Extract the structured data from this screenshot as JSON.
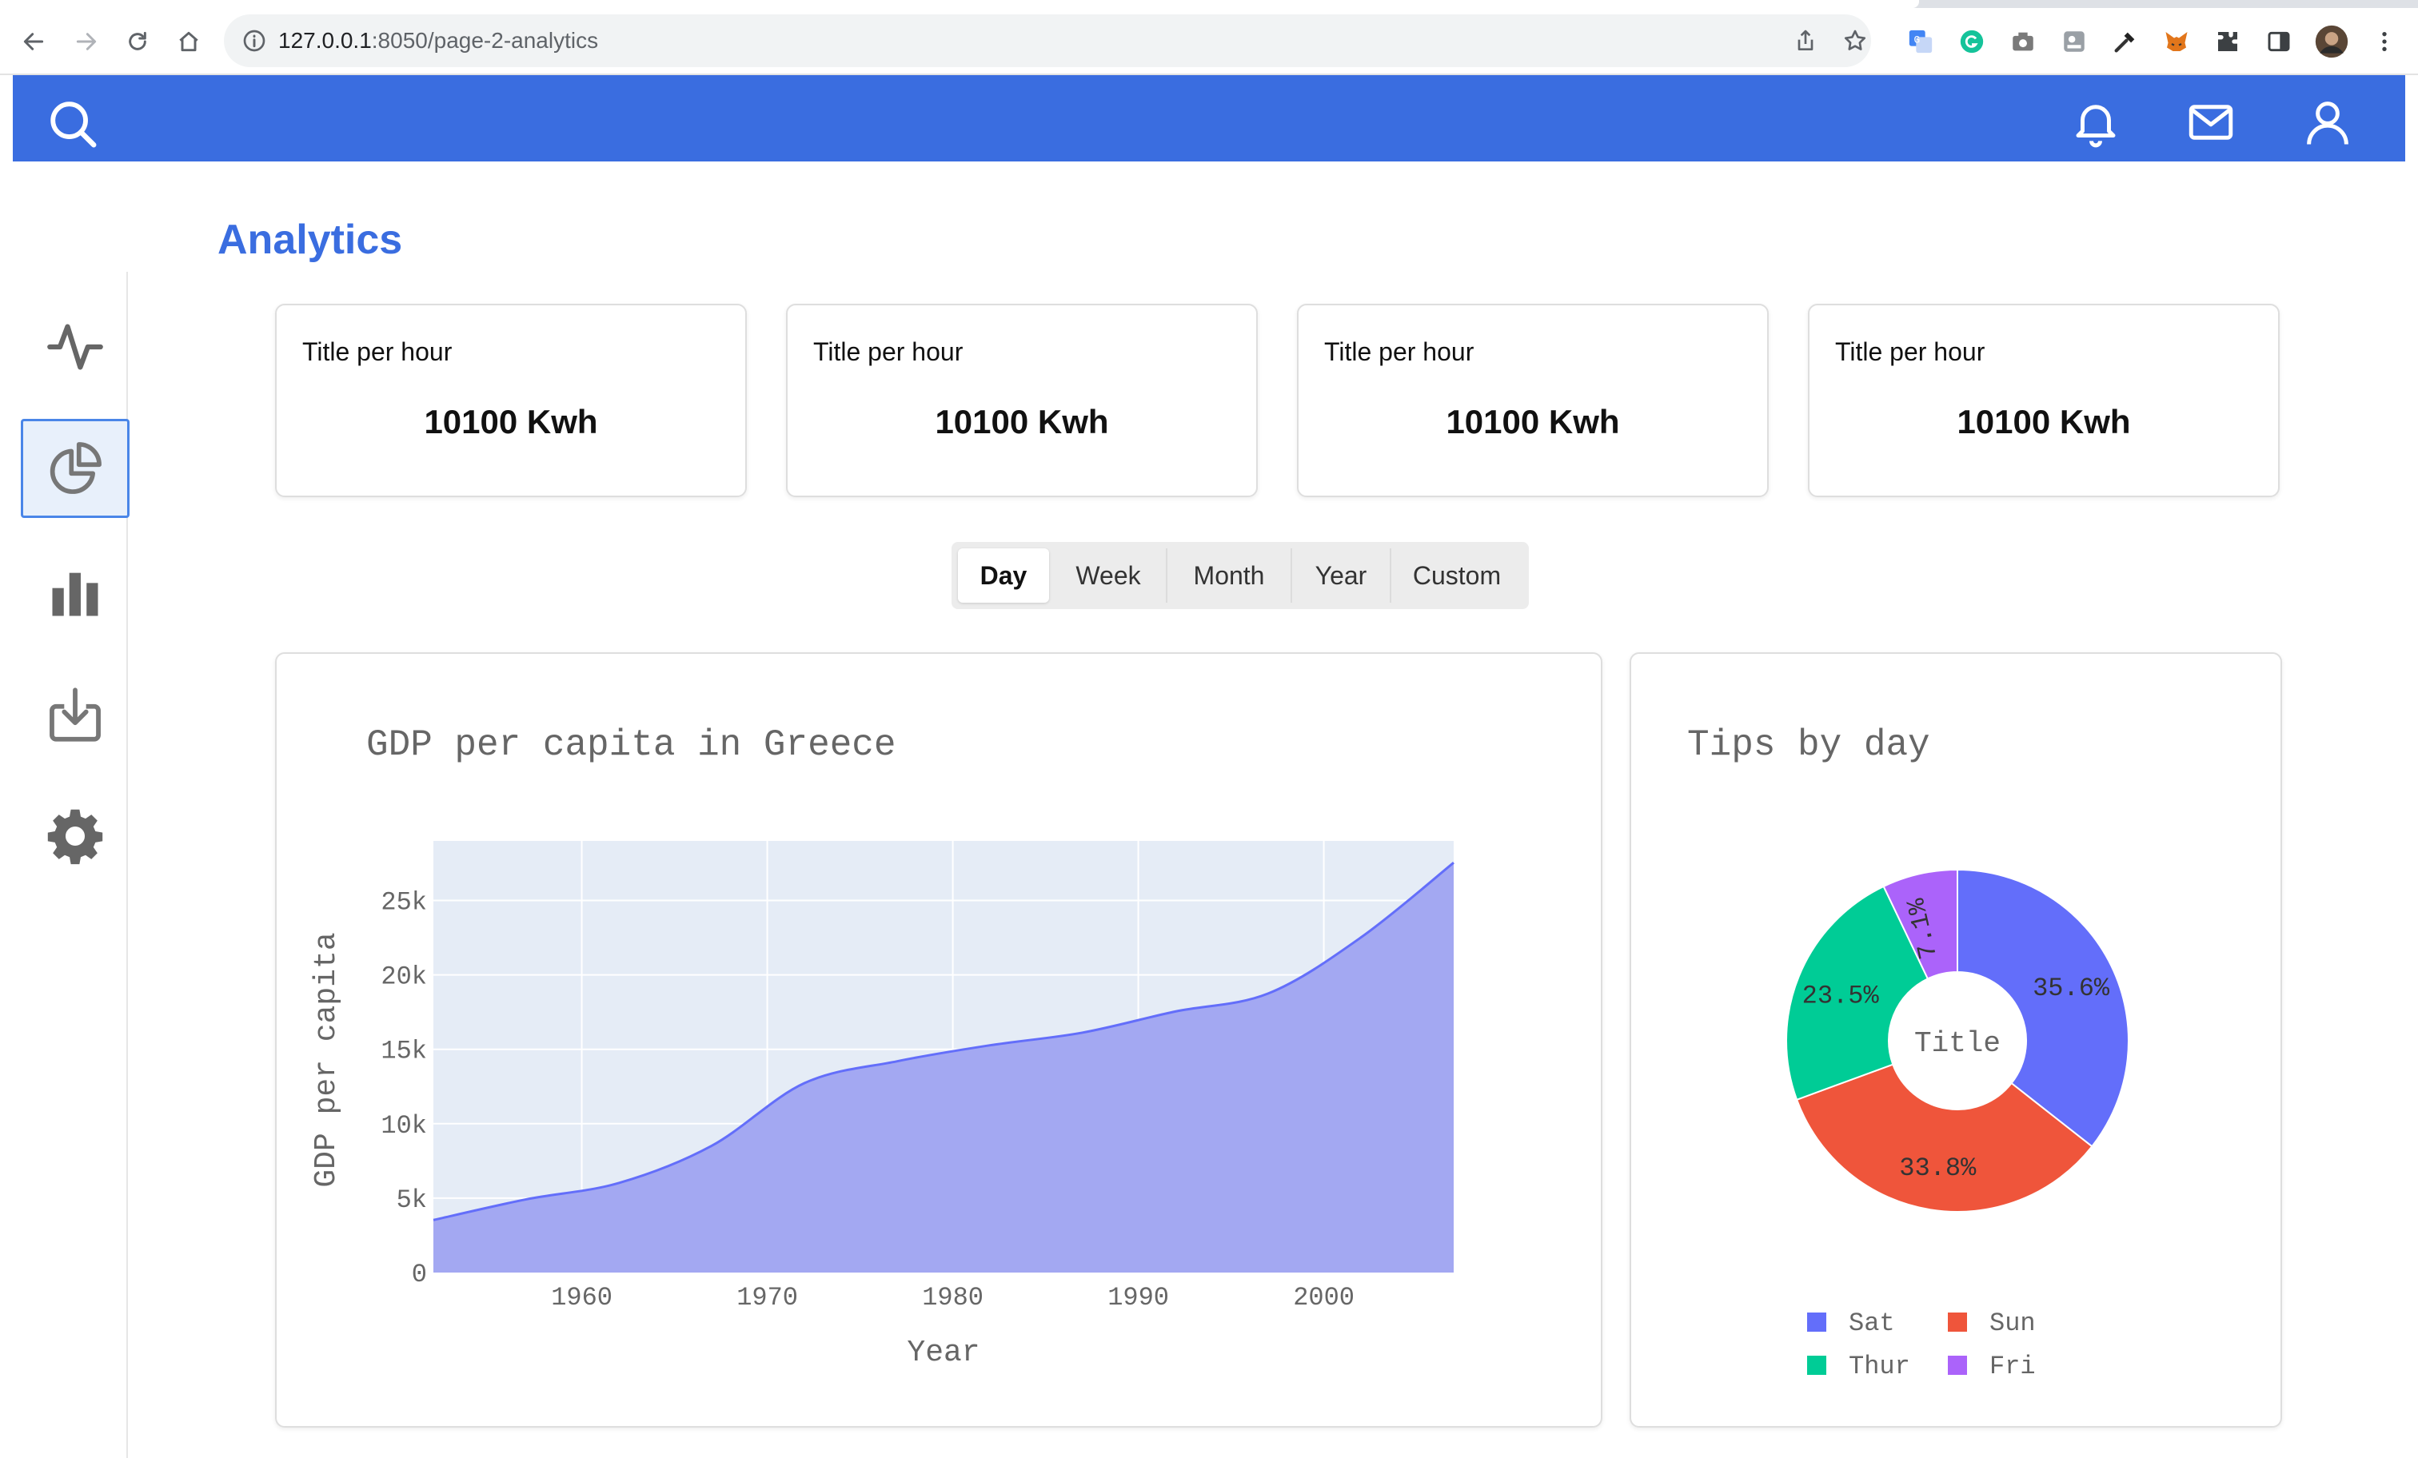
{
  "browser": {
    "url_host": "127.0.0.1",
    "url_path": ":8050/page-2-analytics"
  },
  "header": {
    "icons": [
      "search-icon",
      "bell-icon",
      "mail-icon",
      "user-icon"
    ],
    "color": "#3a6de0"
  },
  "sidebar": {
    "items": [
      {
        "icon": "activity-icon",
        "active": false
      },
      {
        "icon": "pie-chart-icon",
        "active": true
      },
      {
        "icon": "bar-chart-icon",
        "active": false
      },
      {
        "icon": "download-icon",
        "active": false
      },
      {
        "icon": "gear-icon",
        "active": false
      }
    ]
  },
  "page": {
    "title": "Analytics"
  },
  "cards": [
    {
      "title": "Title per hour",
      "value": "10100 Kwh"
    },
    {
      "title": "Title per hour",
      "value": "10100 Kwh"
    },
    {
      "title": "Title per hour",
      "value": "10100 Kwh"
    },
    {
      "title": "Title per hour",
      "value": "10100 Kwh"
    }
  ],
  "period": {
    "options": [
      "Day",
      "Week",
      "Month",
      "Year",
      "Custom"
    ],
    "selected": "Day"
  },
  "chart_data": [
    {
      "type": "area",
      "title": "GDP per capita in Greece",
      "xlabel": "Year",
      "ylabel": "GDP per capita",
      "x": [
        1952,
        1957,
        1962,
        1967,
        1972,
        1977,
        1982,
        1987,
        1992,
        1997,
        2002,
        2007
      ],
      "y": [
        3531,
        4916,
        6017,
        8513,
        12725,
        14196,
        15268,
        16121,
        17541,
        18748,
        22514,
        27538
      ],
      "xlim": [
        1952,
        2007
      ],
      "ylim": [
        0,
        29000
      ],
      "xticks": [
        "1960",
        "1970",
        "1980",
        "1990",
        "2000"
      ],
      "yticks": [
        "0",
        "5k",
        "10k",
        "15k",
        "20k",
        "25k"
      ],
      "grid": true,
      "fill_color": "#a3a8f2",
      "line_color": "#636efa"
    },
    {
      "type": "pie",
      "title": "Tips by day",
      "center_label": "Title",
      "hole": true,
      "labels": [
        "Sat",
        "Sun",
        "Thur",
        "Fri"
      ],
      "values": [
        35.6,
        33.8,
        23.5,
        7.1
      ],
      "value_labels": [
        "35.6%",
        "33.8%",
        "23.5%",
        "7.1%"
      ],
      "colors": [
        "#636efa",
        "#ef553b",
        "#00cc96",
        "#ab63fa"
      ],
      "legend": "bottom"
    }
  ]
}
